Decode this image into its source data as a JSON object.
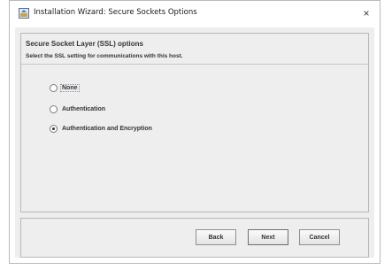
{
  "window": {
    "title": "Installation Wizard: Secure Sockets Options",
    "close_glyph": "×",
    "icon": "installer-icon"
  },
  "panel": {
    "heading": "Secure Socket Layer (SSL) options",
    "subheading": "Select the SSL setting for communications with this host."
  },
  "options": [
    {
      "label": "None",
      "selected": false,
      "focused": true
    },
    {
      "label": "Authentication",
      "selected": false,
      "focused": false
    },
    {
      "label": "Authentication and Encryption",
      "selected": true,
      "focused": false
    }
  ],
  "buttons": {
    "back": "Back",
    "next": "Next",
    "cancel": "Cancel"
  }
}
